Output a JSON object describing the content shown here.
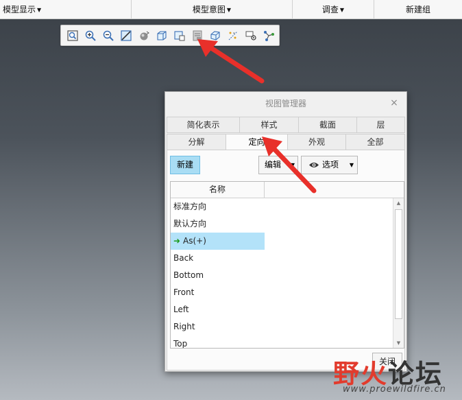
{
  "ribbon": {
    "groups": [
      {
        "label": "模型显示",
        "has_dropdown": true
      },
      {
        "label": "模型意图",
        "has_dropdown": true
      },
      {
        "label": "调查",
        "has_dropdown": true
      },
      {
        "label": "新建组",
        "has_dropdown": false
      }
    ]
  },
  "toolbar": {
    "icons": [
      "zoom-fit-icon",
      "zoom-in-icon",
      "zoom-out-icon",
      "repaint-icon",
      "spin-center-icon",
      "shading-icon",
      "saved-orientation-icon",
      "view-manager-icon",
      "display-style-icon",
      "datum-display-icon",
      "annotation-display-icon",
      "network-icon"
    ]
  },
  "dialog": {
    "title": "视图管理器",
    "close_glyph": "×",
    "tabs_row1": [
      "简化表示",
      "样式",
      "截面",
      "层"
    ],
    "tabs_row2": [
      "分解",
      "定向",
      "外观",
      "全部"
    ],
    "active_tab": "定向",
    "new_button": "新建",
    "edit_button": "编辑",
    "options_button": "选项",
    "column_header": "名称",
    "rows": [
      {
        "label": "标准方向",
        "active": false,
        "selected": false
      },
      {
        "label": "默认方向",
        "active": false,
        "selected": false
      },
      {
        "label": "As(+)",
        "active": true,
        "selected": true
      },
      {
        "label": "Back",
        "active": false,
        "selected": false
      },
      {
        "label": "Bottom",
        "active": false,
        "selected": false
      },
      {
        "label": "Front",
        "active": false,
        "selected": false
      },
      {
        "label": "Left",
        "active": false,
        "selected": false
      },
      {
        "label": "Right",
        "active": false,
        "selected": false
      },
      {
        "label": "Top",
        "active": false,
        "selected": false
      }
    ],
    "close_button": "关闭"
  },
  "watermark": {
    "brand_red": "野火",
    "brand_dark": "论坛",
    "url": "www.proewildfire.cn"
  },
  "colors": {
    "accent_button": "#a9ddf4",
    "selected_row": "#b3e2f9",
    "arrow_red": "#e8302a",
    "active_arrow_green": "#1a9a1a"
  }
}
